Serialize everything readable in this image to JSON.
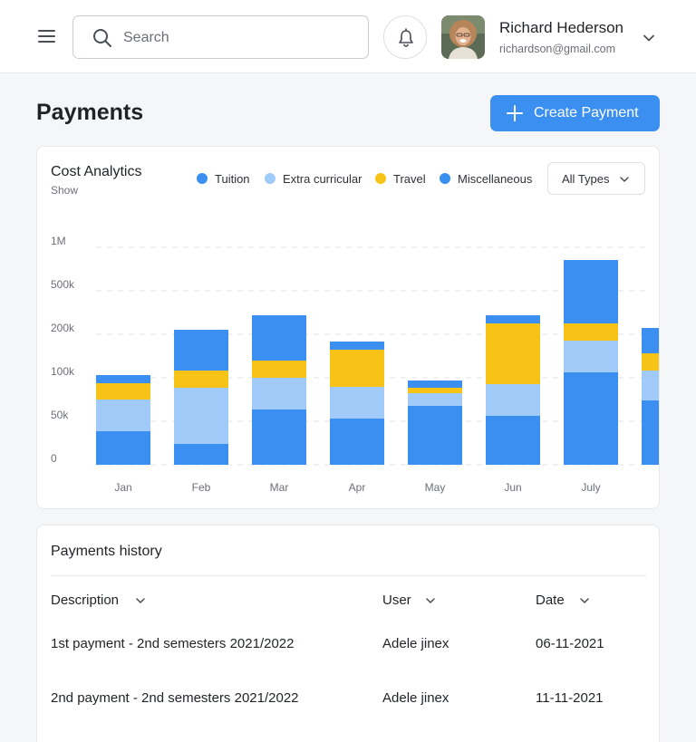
{
  "header": {
    "search_placeholder": "Search",
    "user_name": "Richard Hederson",
    "user_email": "richardson@gmail.com"
  },
  "page": {
    "title": "Payments",
    "create_label": "Create Payment"
  },
  "analytics": {
    "title": "Cost Analytics",
    "subtitle": "Show",
    "filter_label": "All Types",
    "legend": [
      {
        "label": "Tuition",
        "color": "#3b8ff0"
      },
      {
        "label": "Extra curricular",
        "color": "#a0cbf9"
      },
      {
        "label": "Travel",
        "color": "#f6c316"
      },
      {
        "label": "Miscellaneous",
        "color": "#3b8ff0"
      }
    ]
  },
  "chart_data": {
    "type": "bar",
    "stacked": true,
    "categories": [
      "Jan",
      "Feb",
      "Mar",
      "Apr",
      "May",
      "Jun",
      "July"
    ],
    "y_ticks": [
      "0",
      "50k",
      "100k",
      "200k",
      "500k",
      "1M"
    ],
    "series": [
      {
        "name": "Tuition",
        "color": "#3b8ff0",
        "values": [
          37,
          23,
          61,
          51,
          65,
          54,
          102
        ]
      },
      {
        "name": "Extra curricular",
        "color": "#a0cbf9",
        "values": [
          35,
          62,
          35,
          35,
          14,
          35,
          35
        ]
      },
      {
        "name": "Travel",
        "color": "#f6c316",
        "values": [
          18,
          19,
          19,
          41,
          6,
          67,
          19
        ]
      },
      {
        "name": "Miscellaneous",
        "color": "#3b8ff0",
        "values": [
          9,
          45,
          50,
          9,
          8,
          9,
          70
        ]
      }
    ],
    "grid": true,
    "legend_position": "top"
  },
  "history": {
    "title": "Payments history",
    "columns": [
      "Description",
      "User",
      "Date"
    ],
    "rows": [
      [
        "1st payment - 2nd semesters 2021/2022",
        "Adele jinex",
        "06-11-2021"
      ],
      [
        "2nd payment - 2nd semesters 2021/2022",
        "Adele jinex",
        "11-11-2021"
      ]
    ]
  }
}
